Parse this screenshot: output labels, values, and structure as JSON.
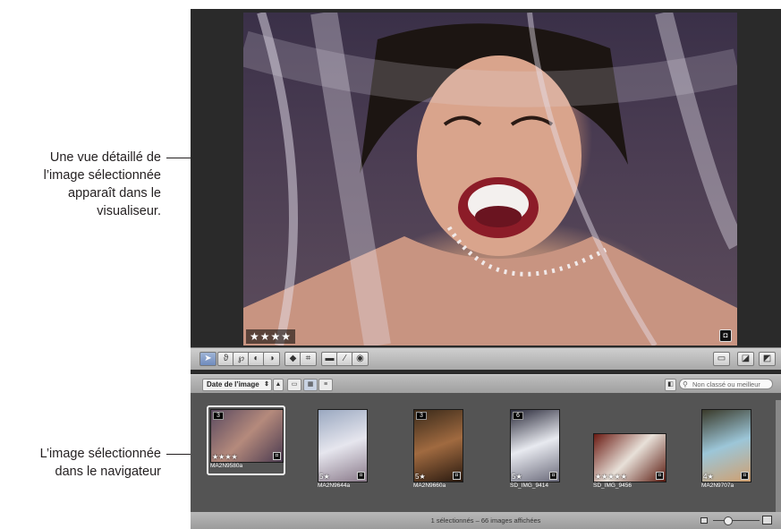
{
  "callouts": {
    "viewer": [
      "Une vue détaillé de",
      "l’image sélectionnée",
      "apparaît dans le",
      "visualiseur."
    ],
    "browser": [
      "L’image sélectionnée",
      "dans le navigateur"
    ]
  },
  "viewer": {
    "rating": "★★★★",
    "badge_icon": "badge-icon"
  },
  "toolbar": {
    "tools": [
      {
        "icon": "select-arrow-icon",
        "glyph": "➤"
      },
      {
        "icon": "lift-icon",
        "glyph": "ϑ"
      },
      {
        "icon": "stamp-icon",
        "glyph": "℘"
      },
      {
        "icon": "rotate-left-icon",
        "glyph": "◐"
      },
      {
        "icon": "rotate-right-icon",
        "glyph": "◑"
      },
      {
        "icon": "straighten-icon",
        "glyph": "◆"
      },
      {
        "icon": "crop-icon",
        "glyph": "⌗"
      },
      {
        "icon": "redeye-icon",
        "glyph": "▬"
      },
      {
        "icon": "brush-icon",
        "glyph": "∕"
      },
      {
        "icon": "target-icon",
        "glyph": "◉"
      }
    ],
    "right_tools": [
      {
        "icon": "display-icon",
        "glyph": "▭"
      },
      {
        "icon": "inspector-icon",
        "glyph": "◪"
      },
      {
        "icon": "panel-icon",
        "glyph": "◩"
      }
    ]
  },
  "navigator": {
    "sort_label": "Date de l’image",
    "search_placeholder": "Non classé ou meilleur",
    "photos": [
      {
        "name": "MA2N9580a",
        "rating": "★★★★",
        "stack": "3",
        "selected": true
      },
      {
        "name": "MA2N9644a",
        "rating": "5★",
        "stack": "",
        "selected": false
      },
      {
        "name": "MA2N9660a",
        "rating": "5★",
        "stack": "3",
        "selected": false
      },
      {
        "name": "SD_IMG_9414",
        "rating": "5★",
        "stack": "6",
        "selected": false
      },
      {
        "name": "SD_IMG_9456",
        "rating": "★★★★★",
        "stack": "",
        "selected": false
      },
      {
        "name": "MA2N9707a",
        "rating": "4★",
        "stack": "",
        "selected": false
      }
    ],
    "status": "1 sélectionnés – 66 images affichées"
  },
  "colors": {
    "viewer_bg": "#2a2a2a",
    "browser_bg": "#545454",
    "active_tool": "#6f8bbd"
  }
}
